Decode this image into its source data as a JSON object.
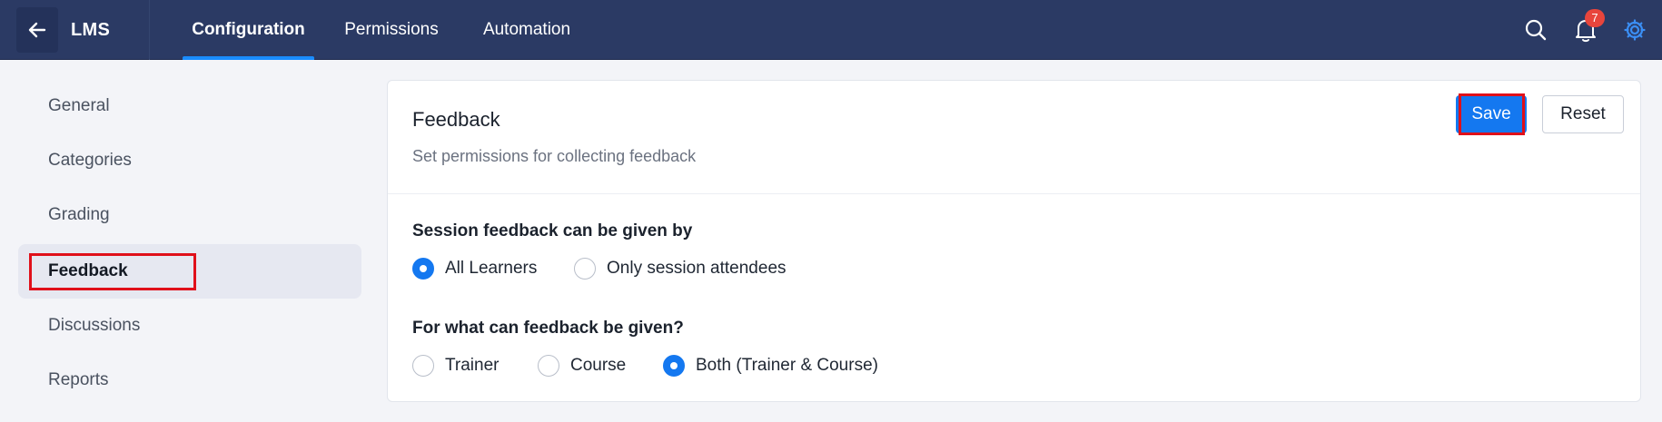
{
  "topbar": {
    "app_name": "LMS",
    "tabs": [
      {
        "label": "Configuration",
        "active": true
      },
      {
        "label": "Permissions",
        "active": false
      },
      {
        "label": "Automation",
        "active": false
      }
    ],
    "notification_count": "7",
    "icons": [
      "back-arrow-icon",
      "search-icon",
      "bell-icon",
      "gear-icon"
    ],
    "accent_color": "#1a8cff",
    "background_color": "#2b3a64"
  },
  "sidebar": {
    "items": [
      {
        "label": "General"
      },
      {
        "label": "Categories"
      },
      {
        "label": "Grading"
      },
      {
        "label": "Feedback",
        "selected": true
      },
      {
        "label": "Discussions"
      },
      {
        "label": "Reports"
      }
    ]
  },
  "main": {
    "title": "Feedback",
    "subtitle": "Set permissions for collecting feedback",
    "save_label": "Save",
    "reset_label": "Reset",
    "questions": [
      {
        "label": "Session feedback can be given by",
        "options": [
          {
            "label": "All Learners",
            "checked": true
          },
          {
            "label": "Only session attendees",
            "checked": false
          }
        ]
      },
      {
        "label": "For what can feedback be given?",
        "options": [
          {
            "label": "Trainer",
            "checked": false
          },
          {
            "label": "Course",
            "checked": false
          },
          {
            "label": "Both (Trainer & Course)",
            "checked": true
          }
        ]
      }
    ],
    "primary_color": "#1478f0"
  }
}
